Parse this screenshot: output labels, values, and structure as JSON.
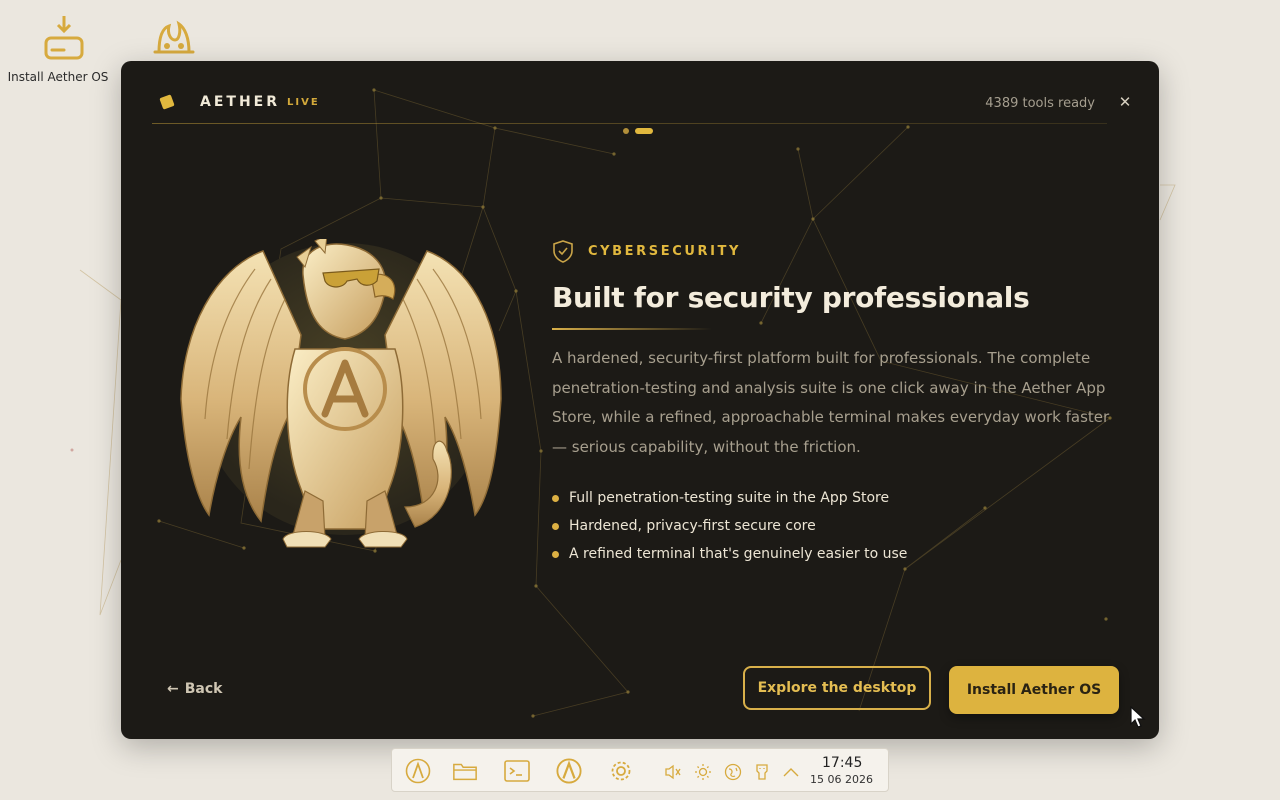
{
  "desktop": {
    "icons": [
      {
        "label": "Install Aether OS"
      },
      {
        "label": ""
      }
    ]
  },
  "dialog": {
    "brand": {
      "name": "AETHER",
      "badge": "LIVE"
    },
    "tools_ready": "4389 tools ready",
    "close_symbol": "✕",
    "pager": {
      "total": 2,
      "active_index": 1
    },
    "eyebrow": "CYBERSECURITY",
    "title": "Built for security professionals",
    "description": "A hardened, security-first platform built for professionals. The complete penetration-testing and analysis suite is one click away in the Aether App Store, while a refined, approachable terminal makes everyday work faster — serious capability, without the friction.",
    "bullets": [
      "Full penetration-testing suite in the App Store",
      "Hardened, privacy-first secure core",
      "A refined terminal that's genuinely easier to use"
    ],
    "back_label": "Back",
    "back_arrow": "←",
    "explore_label": "Explore the desktop",
    "install_label": "Install Aether OS"
  },
  "taskbar": {
    "apps": [
      "aether-icon",
      "folder-icon",
      "terminal-icon",
      "aether-store-icon",
      "settings-icon"
    ],
    "tray": [
      "volume-muted-icon",
      "brightness-icon",
      "network-icon",
      "usb-icon",
      "chevron-up-icon"
    ],
    "clock": {
      "time": "17:45",
      "date": "15 06 2026"
    }
  },
  "colors": {
    "accent": "#ddb33f",
    "dialog_bg": "#1c1a16",
    "desktop_bg": "#ebe7df"
  }
}
